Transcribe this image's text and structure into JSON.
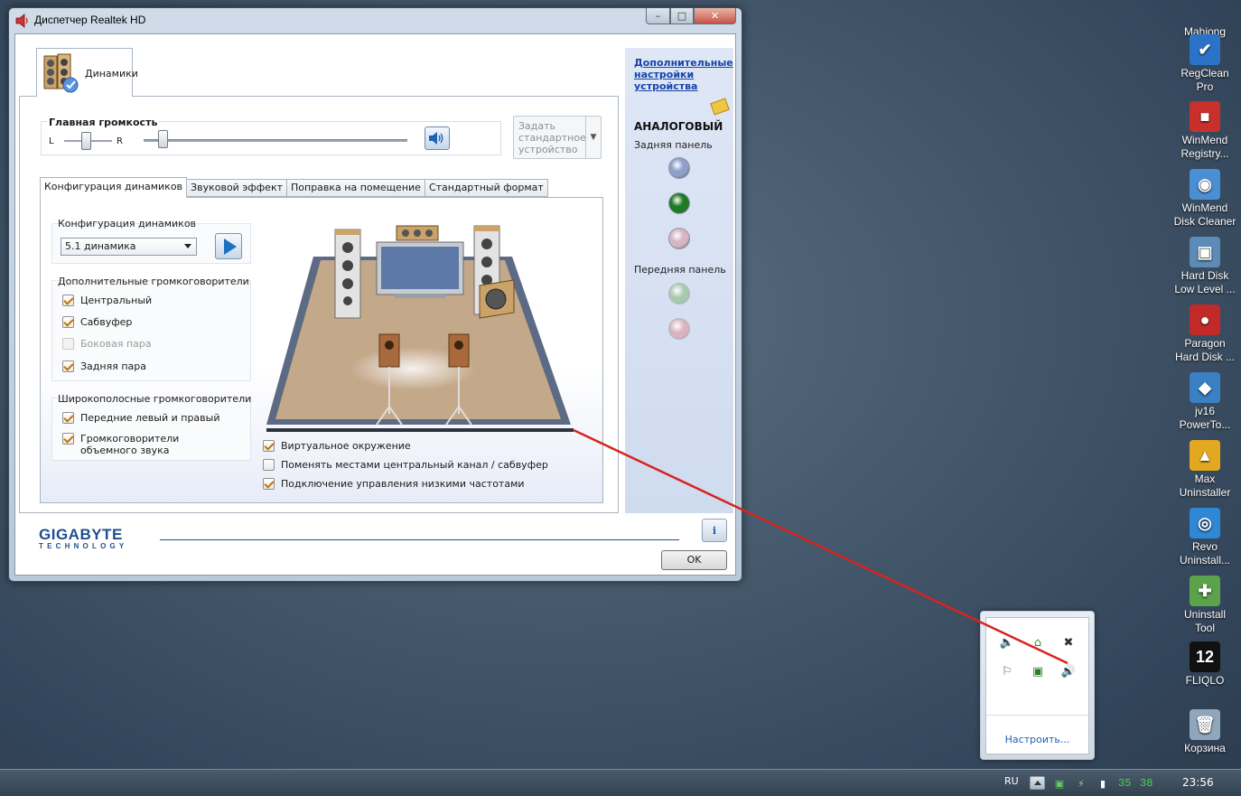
{
  "window": {
    "title": "Диспетчер Realtek HD",
    "buttons": {
      "minimize": "–",
      "maximize": "□",
      "close": "✕"
    }
  },
  "device_tab": {
    "label": "Динамики"
  },
  "volume": {
    "title": "Главная громкость",
    "left_label": "L",
    "right_label": "R",
    "balance_level": 0.5,
    "volume_level": 0.07
  },
  "default_device": {
    "label": "Задать стандартное устройство"
  },
  "tabs": [
    {
      "label": "Конфигурация динамиков",
      "active": true
    },
    {
      "label": "Звуковой эффект",
      "active": false
    },
    {
      "label": "Поправка на помещение",
      "active": false
    },
    {
      "label": "Стандартный формат",
      "active": false
    }
  ],
  "speaker_config": {
    "group_title": "Конфигурация динамиков",
    "selected": "5.1 динамика"
  },
  "extra_speakers": {
    "title": "Дополнительные громкоговорители",
    "items": [
      {
        "label": "Центральный",
        "checked": true,
        "disabled": false
      },
      {
        "label": "Сабвуфер",
        "checked": true,
        "disabled": false
      },
      {
        "label": "Боковая пара",
        "checked": false,
        "disabled": true
      },
      {
        "label": "Задняя пара",
        "checked": true,
        "disabled": false
      }
    ]
  },
  "fullrange_speakers": {
    "title": "Широкополосные громкоговорители",
    "items": [
      {
        "label": "Передние левый и правый",
        "checked": true
      },
      {
        "label": "Громкоговорители объемного звука",
        "checked": true
      }
    ]
  },
  "options": [
    {
      "label": "Виртуальное окружение",
      "checked": true
    },
    {
      "label": "Поменять местами центральный канал / сабвуфер",
      "checked": false
    },
    {
      "label": "Подключение управления низкими частотами",
      "checked": true
    }
  ],
  "side_panel": {
    "link": "Дополнительные настройки устройства",
    "analog": "АНАЛОГОВЫЙ",
    "rear": "Задняя панель",
    "front": "Передняя панель",
    "jack_colors": {
      "rear": [
        "#8ea0c8",
        "#1f7a22",
        "#d6b6c3"
      ],
      "front": [
        "#a9c9ae",
        "#d9b3bf"
      ]
    }
  },
  "brand": {
    "name": "GIGABYTE",
    "sub": "TECHNOLOGY"
  },
  "ok_label": "OK",
  "info_label": "i",
  "desktop_icons": [
    {
      "label": "Mahjong\nTitans",
      "icon": "mahjong-icon",
      "color": "#6b8e23",
      "glyph": "♣"
    },
    {
      "label": "RegClean\nPro",
      "icon": "regclean-icon",
      "color": "#2b73c7",
      "glyph": "✔"
    },
    {
      "label": "WinMend\nRegistry...",
      "icon": "winmend-registry-icon",
      "color": "#c9302c",
      "glyph": "■"
    },
    {
      "label": "WinMend\nDisk Cleaner",
      "icon": "winmend-disk-icon",
      "color": "#4a8fd4",
      "glyph": "◉"
    },
    {
      "label": "Hard Disk\nLow Level ...",
      "icon": "hdd-icon",
      "color": "#5d8bb8",
      "glyph": "▣"
    },
    {
      "label": "Paragon\nHard Disk ...",
      "icon": "paragon-icon",
      "color": "#c22a2a",
      "glyph": "●"
    },
    {
      "label": "jv16\nPowerTo...",
      "icon": "jv16-icon",
      "color": "#3b7fc4",
      "glyph": "◆"
    },
    {
      "label": "Max\nUninstaller",
      "icon": "max-uninstaller-icon",
      "color": "#e3a81f",
      "glyph": "▲"
    },
    {
      "label": "Revo\nUninstall...",
      "icon": "revo-icon",
      "color": "#2e88d6",
      "glyph": "◎"
    },
    {
      "label": "Uninstall\nTool",
      "icon": "uninstall-tool-icon",
      "color": "#5aa34a",
      "glyph": "✚"
    },
    {
      "label": "FLIQLO",
      "icon": "fliqlo-icon",
      "color": "#111111",
      "glyph": "12"
    },
    {
      "label": "Корзина",
      "icon": "recycle-bin-icon",
      "color": "#8fa6bd",
      "glyph": "🗑"
    }
  ],
  "tray_popup": {
    "customize": "Настроить..."
  },
  "taskbar": {
    "lang": "RU",
    "num1": "35",
    "num2": "38",
    "clock": "23:56"
  }
}
